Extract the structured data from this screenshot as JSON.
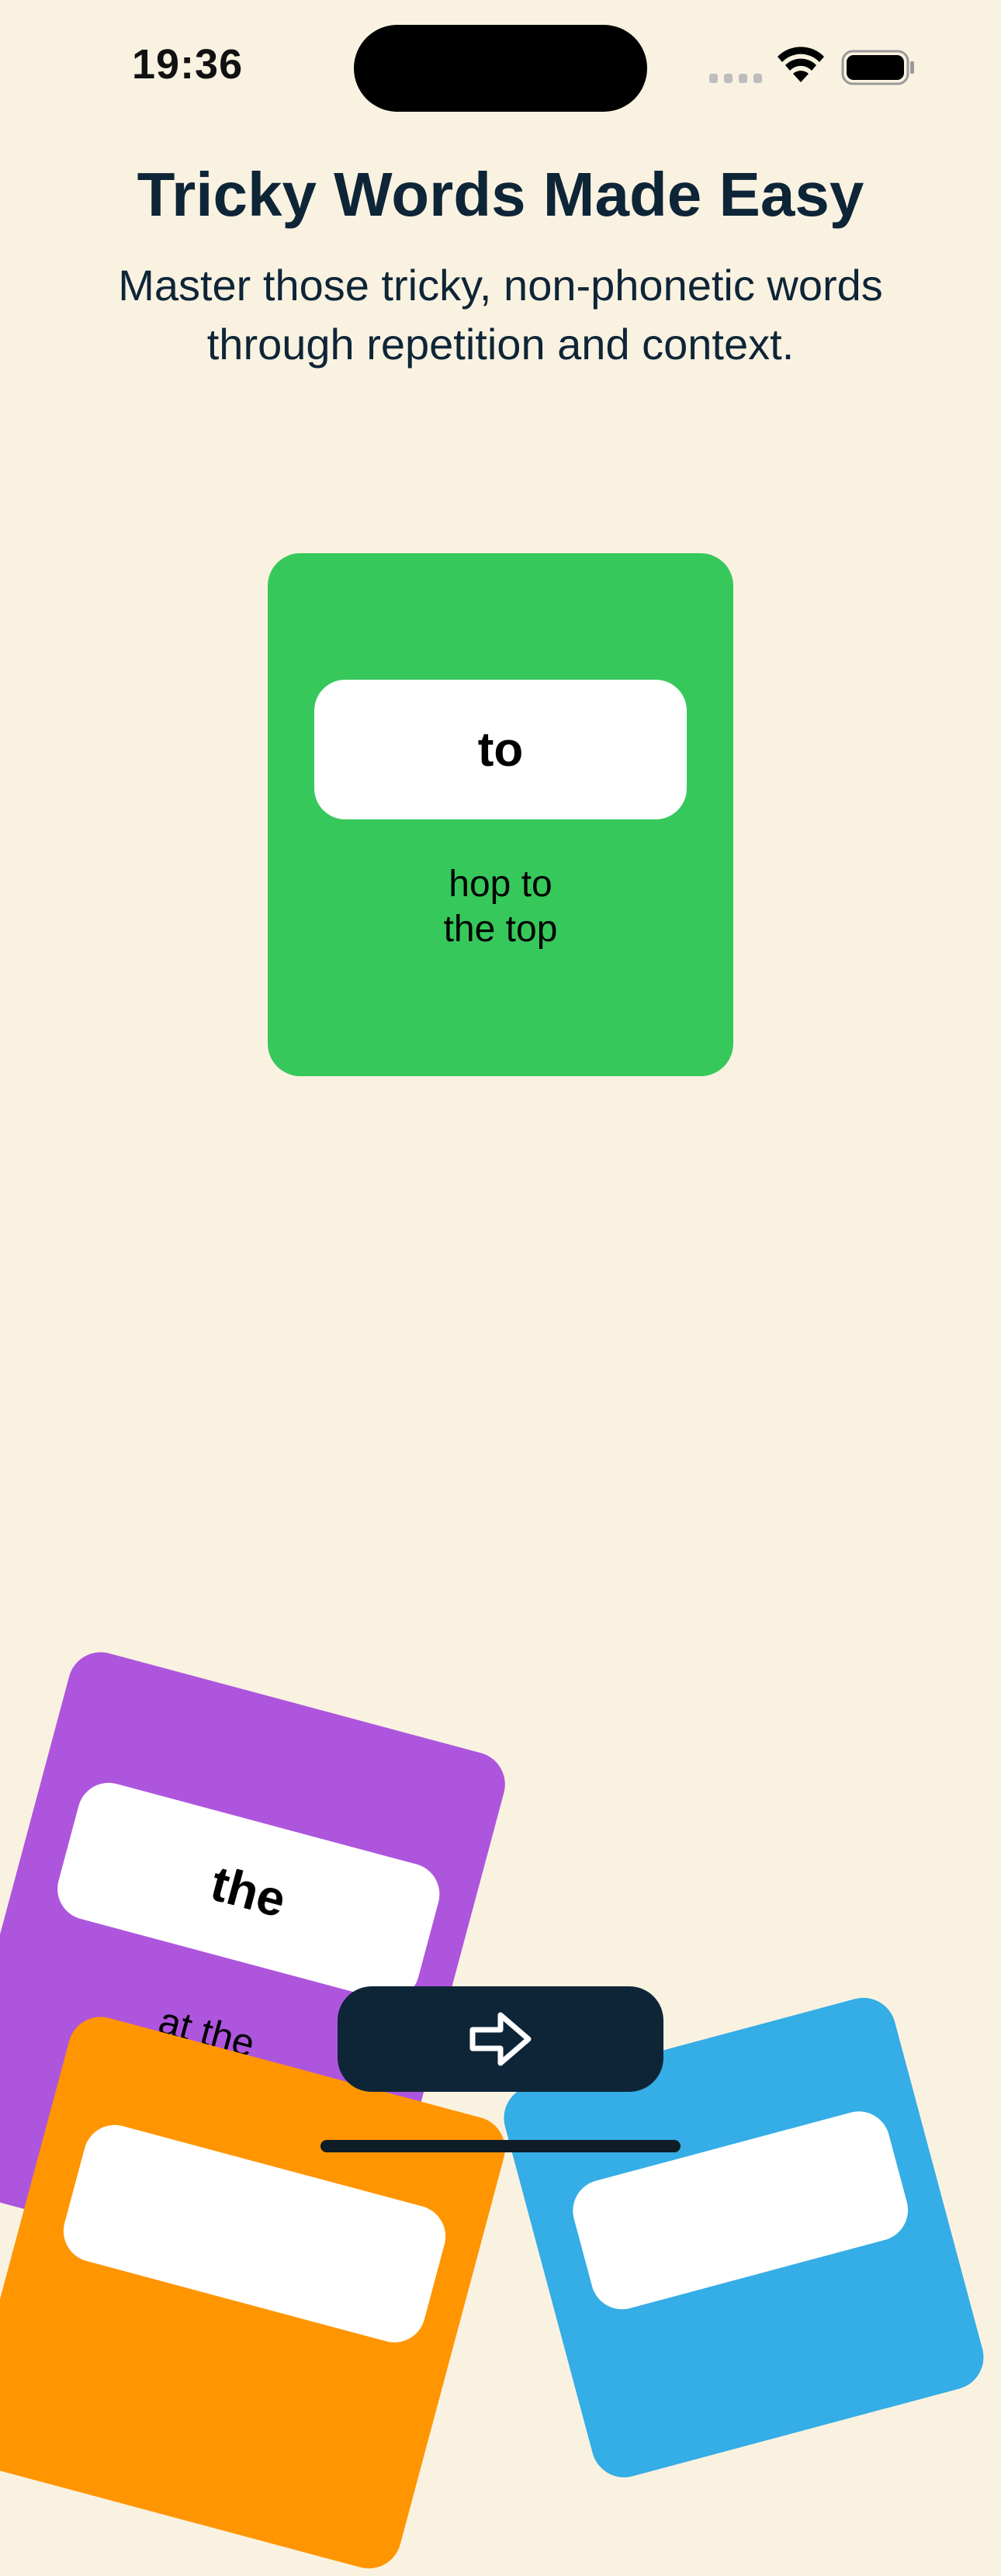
{
  "status_bar": {
    "time": "19:36"
  },
  "header": {
    "title": "Tricky Words Made Easy",
    "subtitle": "Master those tricky, non-phonetic words through repetition and context."
  },
  "cards": {
    "main": {
      "word": "to",
      "caption_line1": "hop to",
      "caption_line2": "the top",
      "color": "#37C85C"
    },
    "purple": {
      "word": "the",
      "caption": "at the",
      "color": "#AE55DD"
    },
    "orange": {
      "color": "#FF9501"
    },
    "blue": {
      "color": "#35ADE6"
    }
  },
  "icons": {
    "next": "arrow-right-icon",
    "wifi": "wifi-icon",
    "battery": "battery-icon",
    "signal": "cellular-signal-icon"
  },
  "colors": {
    "background": "#F9F2E1",
    "primary": "#0E2537"
  }
}
